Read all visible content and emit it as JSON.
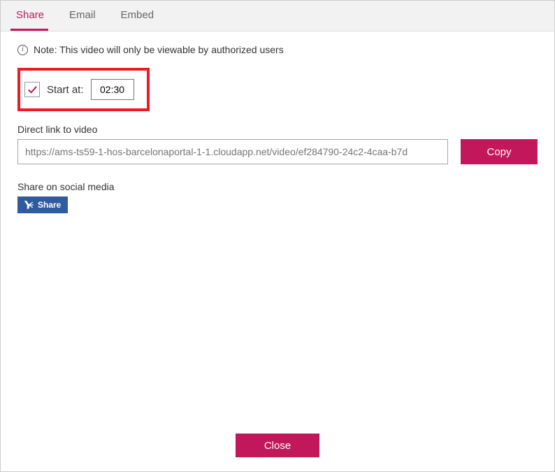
{
  "tabs": {
    "share": "Share",
    "email": "Email",
    "embed": "Embed"
  },
  "note": {
    "text": "Note: This video will only be viewable by authorized users"
  },
  "startAt": {
    "label": "Start at:",
    "value": "02:30",
    "checked": true
  },
  "link": {
    "label": "Direct link to video",
    "url": "https://ams-ts59-1-hos-barcelonaportal-1-1.cloudapp.net/video/ef284790-24c2-4caa-b7d",
    "copy": "Copy"
  },
  "social": {
    "label": "Share on social media",
    "button": "Share"
  },
  "close": "Close",
  "colors": {
    "accent": "#c2185b",
    "yammer": "#2f5c9f",
    "highlight": "#ed1c24"
  }
}
